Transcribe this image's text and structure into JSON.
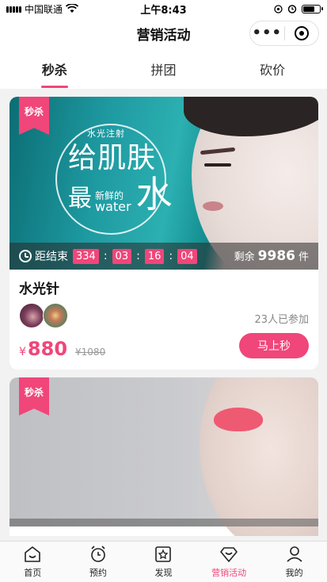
{
  "status_bar": {
    "carrier": "中国联通",
    "time": "上午8:43"
  },
  "nav": {
    "title": "营销活动"
  },
  "tabs": [
    {
      "label": "秒杀",
      "active": true
    },
    {
      "label": "拼团",
      "active": false
    },
    {
      "label": "砍价",
      "active": false
    }
  ],
  "cards": [
    {
      "badge": "秒杀",
      "ad": {
        "small": "水光注射",
        "line1": "给肌肤",
        "zui": "最",
        "sub1": "新鲜的",
        "sub2": "water",
        "shui": "水"
      },
      "timer": {
        "label": "距结束",
        "days": "334",
        "hours": "03",
        "minutes": "16",
        "seconds": "04"
      },
      "stock": {
        "prefix": "剩余",
        "count": "9986",
        "unit": "件"
      },
      "title": "水光针",
      "joined": "23人已参加",
      "price_currency": "¥",
      "price": "880",
      "original_price": "¥1080",
      "buy_label": "马上秒"
    },
    {
      "badge": "秒杀"
    }
  ],
  "tab_bar": [
    {
      "label": "首页",
      "icon": "home-icon",
      "active": false
    },
    {
      "label": "预约",
      "icon": "alarm-clock-icon",
      "active": false
    },
    {
      "label": "发现",
      "icon": "discover-icon",
      "active": false
    },
    {
      "label": "营销活动",
      "icon": "diamond-icon",
      "active": true
    },
    {
      "label": "我的",
      "icon": "user-icon",
      "active": false
    }
  ],
  "colors": {
    "accent": "#f0467a"
  }
}
